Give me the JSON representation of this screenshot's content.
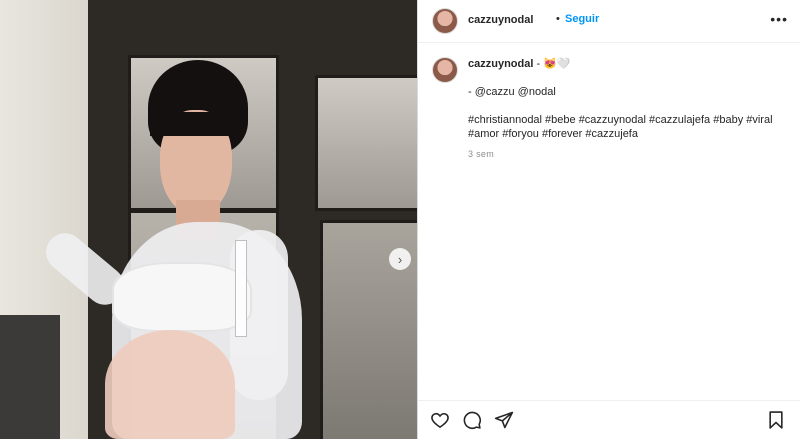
{
  "header": {
    "username": "cazzuynodal",
    "separator": "•",
    "follow_label": "Seguir",
    "more_label": "•••"
  },
  "caption": {
    "username": "cazzuynodal",
    "first_line_suffix": " - 😻🤍",
    "mentions": "- @cazzu @nodal",
    "hashtags": "#christiannodal #bebe #cazzuynodal #cazzulajefa #baby #viral #amor #foryou #forever #cazzujefa",
    "time": "3 sem"
  },
  "media": {
    "next_glyph": "›"
  },
  "icons": [
    "heart-icon",
    "comment-icon",
    "share-icon",
    "bookmark-icon",
    "chevron-right-icon",
    "more-icon"
  ],
  "colors": {
    "accent": "#0095f6",
    "text": "#262626",
    "muted": "#8e8e8e"
  }
}
